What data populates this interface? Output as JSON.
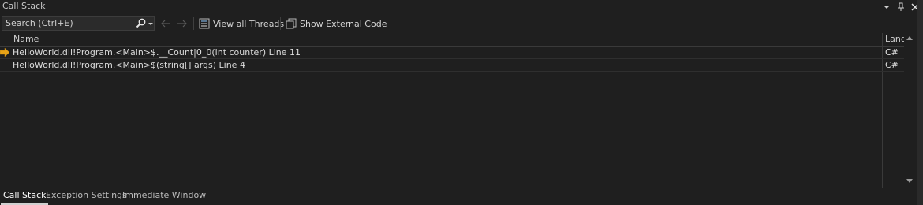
{
  "window": {
    "title": "Call Stack",
    "actions": [
      {
        "name": "dropdown-icon",
        "glyph": "▾"
      },
      {
        "name": "pin-icon",
        "glyph": "⊥"
      },
      {
        "name": "close-icon",
        "glyph": "✕"
      }
    ]
  },
  "toolbar": {
    "search_placeholder": "Search (Ctrl+E)",
    "view_all_threads": "View all Threads",
    "show_external_code": "Show External Code"
  },
  "grid": {
    "columns": {
      "name": "Name",
      "lang": "Lang"
    },
    "rows": [
      {
        "name": "HelloWorld.dll!Program.<Main>$.__Count|0_0(int counter) Line 11",
        "lang": "C#",
        "current": true
      },
      {
        "name": "HelloWorld.dll!Program.<Main>$(string[] args) Line 4",
        "lang": "C#",
        "current": false
      }
    ]
  },
  "tabs": [
    {
      "label": "Call Stack",
      "active": true
    },
    {
      "label": "Exception Settings",
      "active": false
    },
    {
      "label": "Immediate Window",
      "active": false
    }
  ],
  "colors": {
    "background": "#1f1f1f",
    "current_frame_arrow": "#e8a317",
    "text": "#dcdcdc"
  }
}
